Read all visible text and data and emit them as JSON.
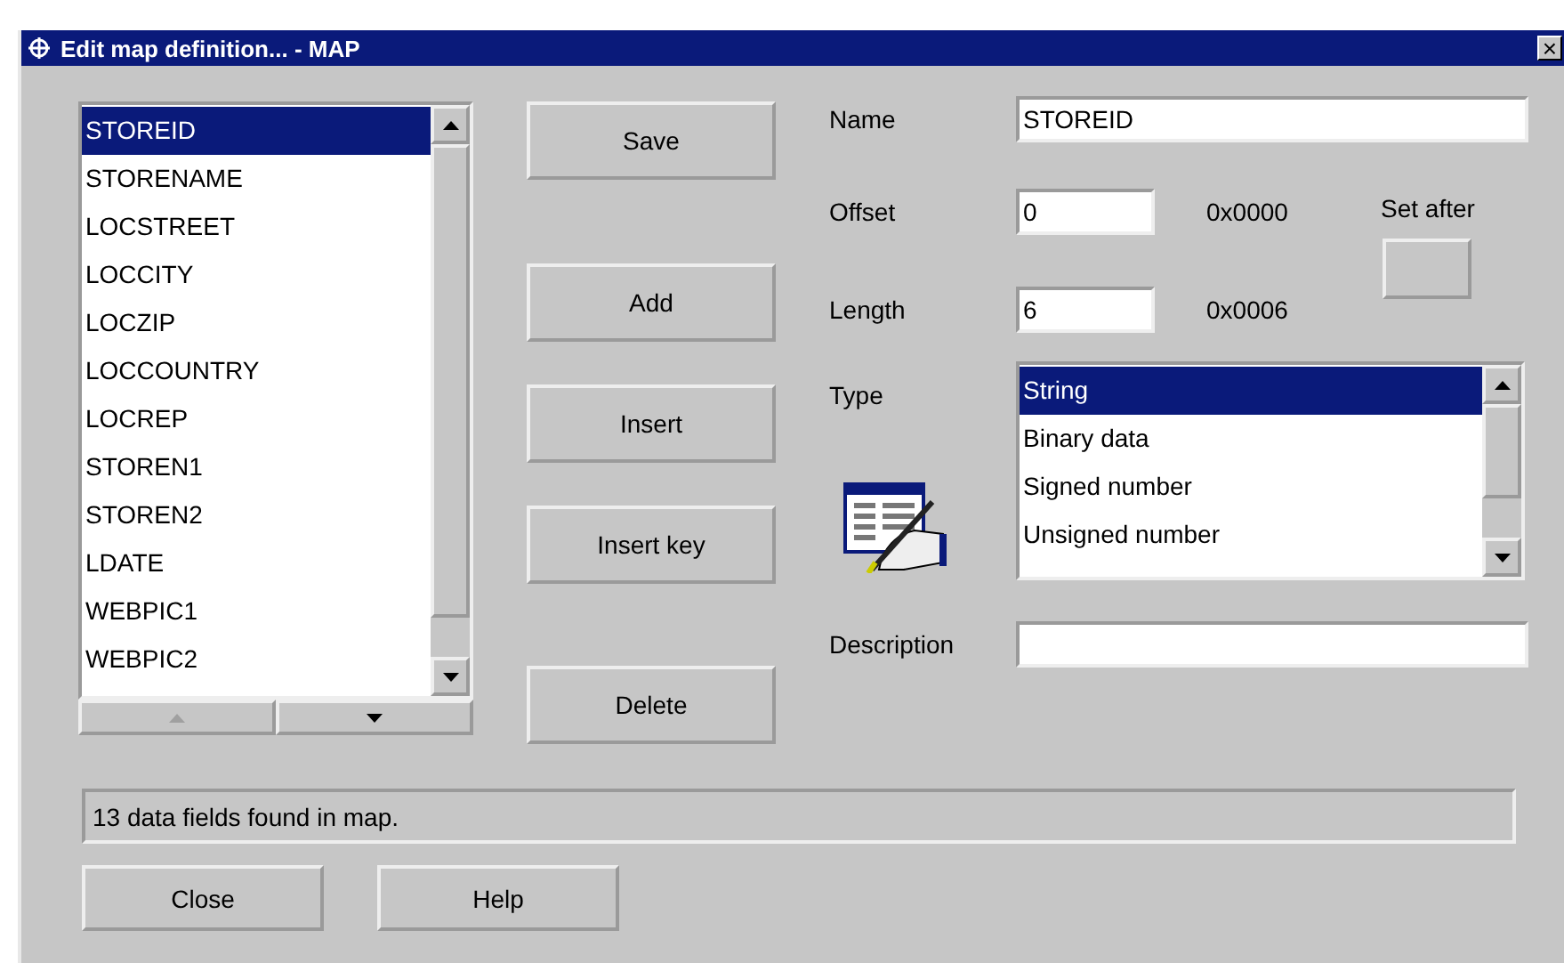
{
  "window": {
    "title": "Edit map definition... - MAP",
    "close": "×"
  },
  "fields_list": {
    "items": [
      {
        "label": "STOREID",
        "selected": true
      },
      {
        "label": "STORENAME",
        "selected": false
      },
      {
        "label": "LOCSTREET",
        "selected": false
      },
      {
        "label": "LOCCITY",
        "selected": false
      },
      {
        "label": "LOCZIP",
        "selected": false
      },
      {
        "label": "LOCCOUNTRY",
        "selected": false
      },
      {
        "label": "LOCREP",
        "selected": false
      },
      {
        "label": "STOREN1",
        "selected": false
      },
      {
        "label": "STOREN2",
        "selected": false
      },
      {
        "label": "LDATE",
        "selected": false
      },
      {
        "label": "WEBPIC1",
        "selected": false
      },
      {
        "label": "WEBPIC2",
        "selected": false
      }
    ],
    "move_up_disabled": true
  },
  "actions": [
    "Save",
    "Add",
    "Insert",
    "Insert key",
    "Delete"
  ],
  "name": {
    "label": "Name",
    "value": "STOREID"
  },
  "offset": {
    "label": "Offset",
    "value": "0",
    "hex": "0x0000"
  },
  "length": {
    "label": "Length",
    "value": "6",
    "hex": "0x0006"
  },
  "set_after": {
    "label": "Set after"
  },
  "type": {
    "label": "Type",
    "items": [
      {
        "label": "String",
        "selected": true
      },
      {
        "label": "Binary data",
        "selected": false
      },
      {
        "label": "Signed number",
        "selected": false
      },
      {
        "label": "Unsigned number",
        "selected": false
      }
    ]
  },
  "description": {
    "label": "Description"
  },
  "status": "13 data fields found in map.",
  "buttons": [
    "Close",
    "Help"
  ]
}
